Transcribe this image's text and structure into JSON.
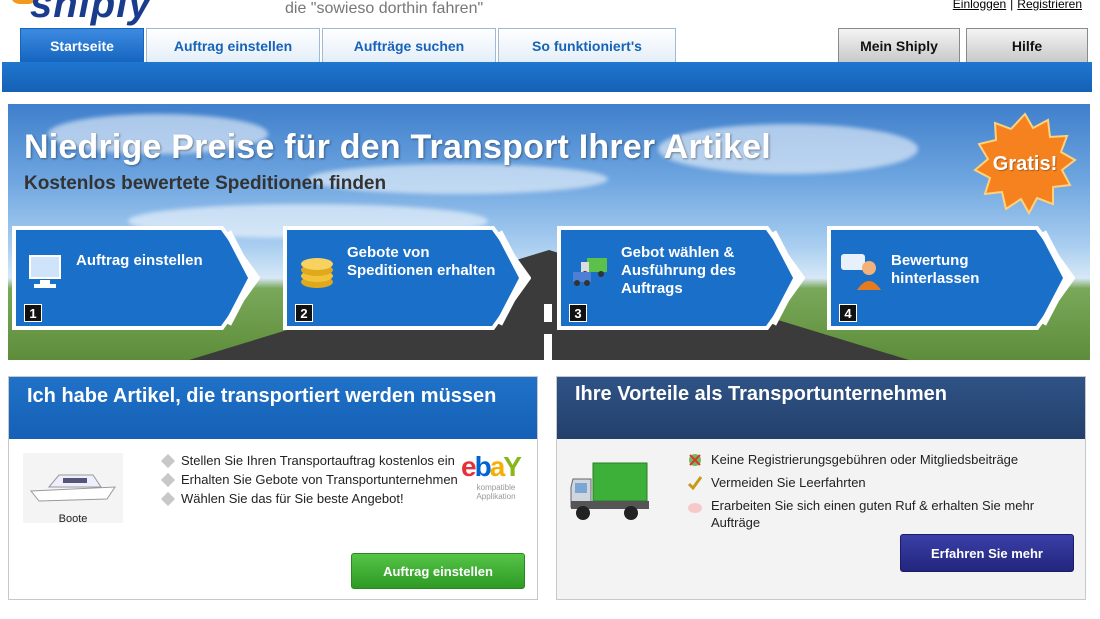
{
  "header": {
    "logo_text": "shiply",
    "tagline": "die \"sowieso dorthin fahren\"",
    "links": {
      "login": "Einloggen",
      "register": "Registrieren",
      "separator": "|"
    }
  },
  "tabs": {
    "left": [
      {
        "label": "Startseite",
        "active": true
      },
      {
        "label": "Auftrag einstellen",
        "active": false
      },
      {
        "label": "Aufträge suchen",
        "active": false
      },
      {
        "label": "So funktioniert's",
        "active": false
      }
    ],
    "right": [
      {
        "label": "Mein Shiply"
      },
      {
        "label": "Hilfe"
      }
    ]
  },
  "hero": {
    "title": "Niedrige Preise für den Transport Ihrer Artikel",
    "subtitle": "Kostenlos bewertete Speditionen finden",
    "badge": "Gratis!",
    "steps": [
      {
        "number": "1",
        "label": "Auftrag einstellen",
        "icon": "computer-icon"
      },
      {
        "number": "2",
        "label": "Gebote von Speditionen erhalten",
        "icon": "coins-icon"
      },
      {
        "number": "3",
        "label": "Gebot wählen & Ausführung des Auftrags",
        "icon": "trucks-icon"
      },
      {
        "number": "4",
        "label": "Bewertung hinterlassen",
        "icon": "user-feedback-icon"
      }
    ]
  },
  "panel_left": {
    "heading": "Ich habe Artikel, die transportiert werden müssen",
    "image_caption": "Boote",
    "bullets": [
      "Stellen Sie Ihren Transportauftrag kostenlos ein",
      "Erhalten Sie Gebote von Transportunternehmen",
      "Wählen Sie das für Sie beste Angebot!"
    ],
    "partner_sub": "kompatible Applikation",
    "button": "Auftrag einstellen"
  },
  "panel_right": {
    "heading": "Ihre Vorteile als Transportunternehmen",
    "bullets": [
      "Keine Registrierungsgebühren oder Mitgliedsbeiträge",
      "Vermeiden Sie Leerfahrten",
      "Erarbeiten Sie sich einen guten Ruf & erhalten Sie mehr Aufträge"
    ],
    "button": "Erfahren Sie mehr"
  },
  "colors": {
    "tab_active": "#1565c0",
    "hero_step": "#1a6fc9",
    "green_button": "#2e9a25",
    "navy_button": "#22267c",
    "badge": "#f5821f"
  }
}
